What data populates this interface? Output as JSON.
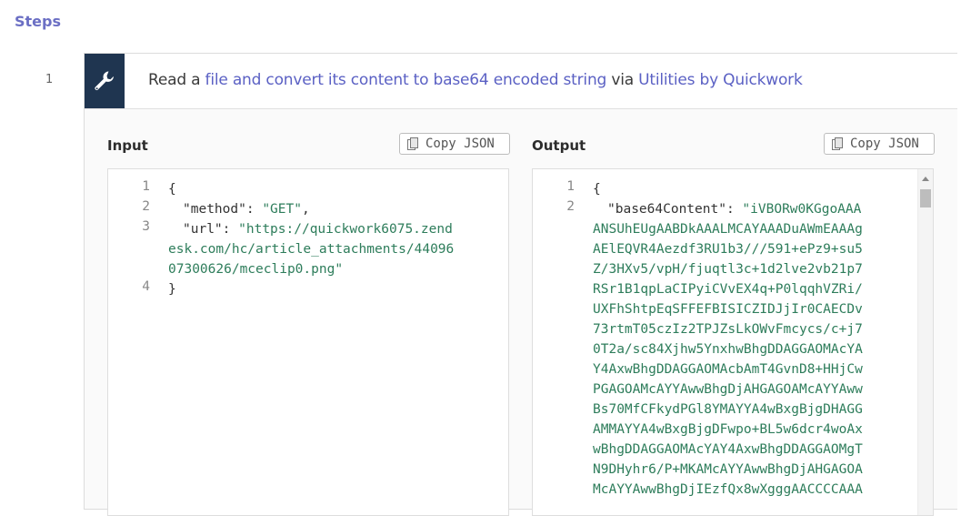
{
  "steps_title": "Steps",
  "step": {
    "number": "1",
    "icon": "wrench-icon",
    "description": {
      "prefix": "Read a ",
      "action_link": "file and convert its content to base64 encoded string",
      "middle": " via ",
      "app_link": "Utilities by Quickwork"
    }
  },
  "input": {
    "label": "Input",
    "copy_label": "Copy JSON",
    "line_numbers": [
      "1",
      "2",
      "3",
      "4"
    ],
    "lines": {
      "l1": "{",
      "l2_key": "\"method\"",
      "l2_colon": ": ",
      "l2_val": "\"GET\"",
      "l2_comma": ",",
      "l3_key": "\"url\"",
      "l3_colon": ": ",
      "l3_val_1": "\"https://quickwork6075.zend",
      "l3_val_2": "esk.com/hc/article_attachments/44096",
      "l3_val_3": "07300626/mceclip0.png\"",
      "l4": "}"
    }
  },
  "output": {
    "label": "Output",
    "copy_label": "Copy JSON",
    "line_numbers": [
      "1",
      "2"
    ],
    "lines": {
      "l1": "{",
      "l2_key": "\"base64Content\"",
      "l2_colon": ": ",
      "value_lines": [
        "\"iVBORw0KGgoAAA",
        "ANSUhEUgAABDkAAALMCAYAAADuAWmEAAAg",
        "AElEQVR4Aezdf3RU1b3///591+ePz9+su5",
        "Z/3HXv5/vpH/fjuqtl3c+1d2lve2vb21p7",
        "RSr1B1qpLaCIPyiCVvEX4q+P0lqqhVZRi/",
        "UXFhShtpEqSFFEFBISICZIDJjIr0CAECDv",
        "73rtmT05czIz2TPJZsLkOWvFmcycs/c+j7",
        "0T2a/sc84Xjhw5YnxhwBhgDDAGGAOMAcYA",
        "Y4AxwBhgDDAGGAOMAcbAmT4GvnD8+HHjCw",
        "PGAGOAMcAYYAwwBhgDjAHGAGOAMcAYYAww",
        "Bs70MfCFkydPGl8YMAYYA4wBxgBjgDHAGG",
        "AMMAYYA4wBxgBjgDFwpo+BL5w6dcr4woAx",
        "wBhgDDAGGAOMAcYAY4AxwBhgDDAGGAOMgT",
        "N9DHyhr6/P+MKAMcAYYAwwBhgDjAHGAGOA",
        "McAYYAwwBhgDjIEzfQx8wXgggAACCCCAAA"
      ]
    }
  }
}
